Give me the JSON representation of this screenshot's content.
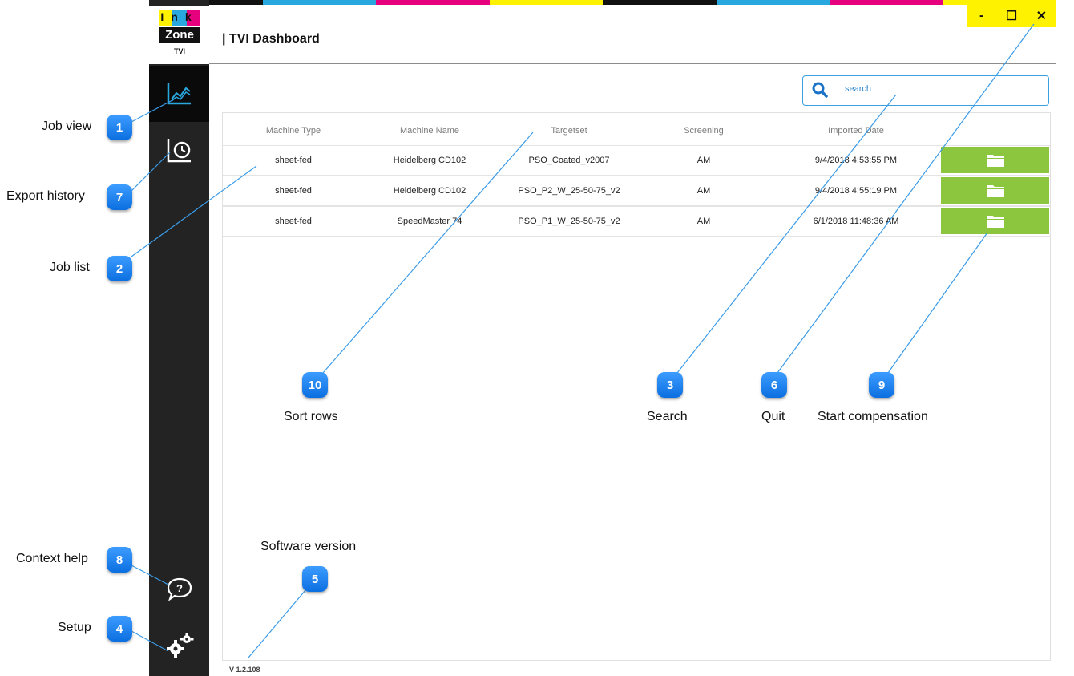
{
  "app": {
    "logo": {
      "line1": "Ink",
      "line2": "Zone",
      "line3": "TVI"
    },
    "title": "| TVI Dashboard",
    "window_controls": {
      "minimize": "-",
      "maximize": "☐",
      "close": "✕"
    },
    "cmyk_colors": [
      "#111111",
      "#29a8e0",
      "#e6007e",
      "#fff200",
      "#111111",
      "#29a8e0",
      "#e6007e",
      "#fff200"
    ]
  },
  "search": {
    "placeholder": "search"
  },
  "table": {
    "headers": [
      "Machine Type",
      "Machine Name",
      "Targetset",
      "Screening",
      "Imported Date"
    ],
    "rows": [
      [
        "sheet-fed",
        "Heidelberg CD102",
        "PSO_Coated_v2007",
        "AM",
        "9/4/2018 4:53:55 PM"
      ],
      [
        "sheet-fed",
        "Heidelberg CD102",
        "PSO_P2_W_25-50-75_v2",
        "AM",
        "9/4/2018 4:55:19 PM"
      ],
      [
        "sheet-fed",
        "SpeedMaster 74",
        "PSO_P1_W_25-50-75_v2",
        "AM",
        "6/1/2018 11:48:36 AM"
      ]
    ]
  },
  "version": "V 1.2.108",
  "callouts": {
    "job_view": {
      "number": "1",
      "label": "Job view"
    },
    "job_list": {
      "number": "2",
      "label": "Job list"
    },
    "search": {
      "number": "3",
      "label": "Search"
    },
    "setup": {
      "number": "4",
      "label": "Setup"
    },
    "software_version": {
      "number": "5",
      "label": "Software version"
    },
    "quit": {
      "number": "6",
      "label": "Quit"
    },
    "export_history": {
      "number": "7",
      "label": "Export history"
    },
    "context_help": {
      "number": "8",
      "label": "Context help"
    },
    "start_compensation": {
      "number": "9",
      "label": "Start compensation"
    },
    "sort_rows": {
      "number": "10",
      "label": "Sort rows"
    }
  },
  "colors": {
    "accent": "#8cc63f",
    "sidebar": "#232323",
    "badge": "#0b6fe0",
    "leader_line": "#3a9be8",
    "chart_icon": "#29a8e0"
  }
}
